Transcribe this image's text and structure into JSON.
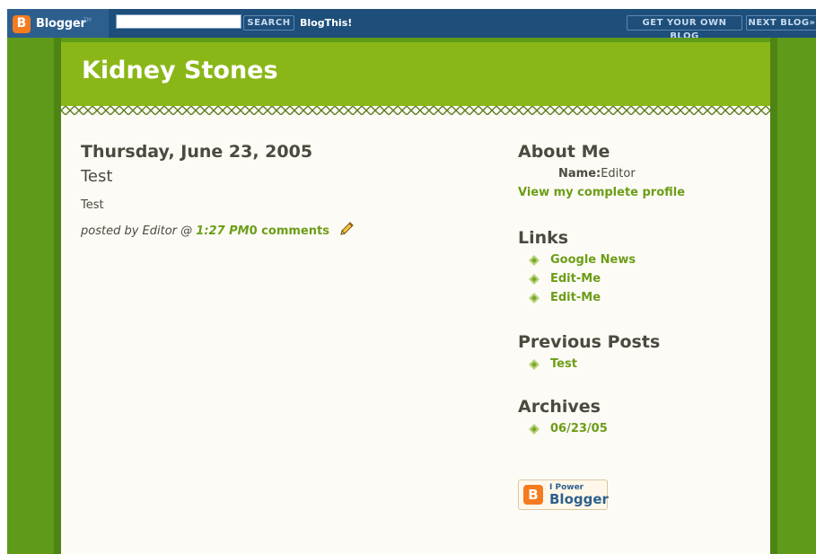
{
  "navbar": {
    "logo_text": "Blogger",
    "logo_tm": "TM",
    "logo_letter": "B",
    "search_value": "",
    "search_button": "SEARCH",
    "blogthis": "BlogThis!",
    "get_own_blog": "GET YOUR OWN BLOG",
    "next_blog": "NEXT BLOG»"
  },
  "header": {
    "title": "Kidney Stones"
  },
  "post": {
    "date": "Thursday, June 23, 2005",
    "title": "Test",
    "body": "Test",
    "posted_by": "posted by Editor @ ",
    "time": "1:27 PM",
    "comments": "0 comments"
  },
  "sidebar": {
    "about_heading": "About Me",
    "name_label": "Name:",
    "name_value": "Editor",
    "view_profile": "View my complete profile",
    "links_heading": "Links",
    "links": [
      "Google News",
      "Edit-Me",
      "Edit-Me"
    ],
    "previous_heading": "Previous Posts",
    "previous_posts": [
      "Test"
    ],
    "archives_heading": "Archives",
    "archives": [
      "06/23/05"
    ],
    "badge_small": "I Power",
    "badge_big": "Blogger",
    "badge_letter": "B"
  },
  "colors": {
    "navbar": "#1e4f7a",
    "header_green": "#8ab717",
    "frame_green": "#5f9a1a",
    "link_green": "#6c9d17",
    "content_bg": "#fdfbf6",
    "text": "#4a4a3f"
  }
}
